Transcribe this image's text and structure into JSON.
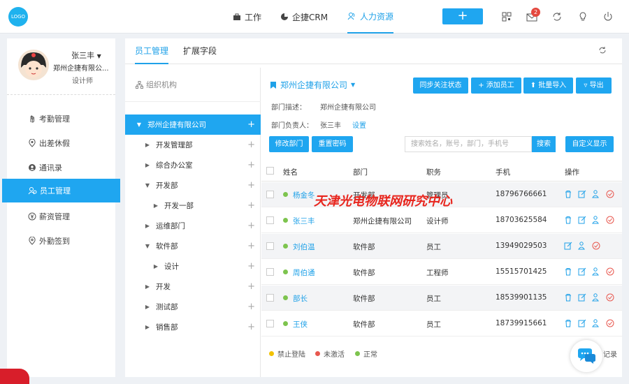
{
  "topbar": {
    "logo": "LOGO",
    "nav": [
      {
        "label": "工作",
        "icon": "briefcase-icon"
      },
      {
        "label": "企捷CRM",
        "icon": "pie-icon"
      },
      {
        "label": "人力资源",
        "icon": "people-icon"
      }
    ],
    "active_nav": "人力资源",
    "plus_label": "+",
    "badge_count": "2"
  },
  "user": {
    "name": "张三丰",
    "company": "郑州企捷有限公...",
    "role": "设计师"
  },
  "sidebar": {
    "items": [
      {
        "label": "考勤管理",
        "icon": "hand-icon"
      },
      {
        "label": "出差休假",
        "icon": "location-icon"
      },
      {
        "label": "通讯录",
        "icon": "contact-icon"
      },
      {
        "label": "员工管理",
        "icon": "staff-icon"
      },
      {
        "label": "薪资管理",
        "icon": "yen-icon"
      },
      {
        "label": "外勤签到",
        "icon": "pin-icon"
      }
    ],
    "active": "员工管理"
  },
  "tabs": [
    "员工管理",
    "扩展字段"
  ],
  "org": {
    "title": "组织机构",
    "tree": [
      {
        "label": "郑州企捷有限公司",
        "caret": "▼",
        "depth": 0,
        "active": true
      },
      {
        "label": "开发管理部",
        "caret": "▶",
        "depth": 1
      },
      {
        "label": "综合办公室",
        "caret": "▶",
        "depth": 1
      },
      {
        "label": "开发部",
        "caret": "▼",
        "depth": 1
      },
      {
        "label": "开发一部",
        "caret": "▶",
        "depth": 2
      },
      {
        "label": "运维部门",
        "caret": "▶",
        "depth": 1
      },
      {
        "label": "软件部",
        "caret": "▼",
        "depth": 1
      },
      {
        "label": "设计",
        "caret": "▶",
        "depth": 2
      },
      {
        "label": "开发",
        "caret": "▶",
        "depth": 1
      },
      {
        "label": "测试部",
        "caret": "▶",
        "depth": 1
      },
      {
        "label": "销售部",
        "caret": "▶",
        "depth": 1
      }
    ]
  },
  "company": {
    "name": "郑州企捷有限公司",
    "desc_label": "部门描述：",
    "desc_value": "郑州企捷有限公司",
    "head_label": "部门负责人：",
    "head_value": "张三丰",
    "head_link": "设置"
  },
  "actions": {
    "sync": "同步关注状态",
    "add": "+ 添加员工",
    "import": "批量导入",
    "export": "导出",
    "edit_dept": "修改部门",
    "reset_pwd": "重置密码",
    "search_placeholder": "搜索姓名，账号，部门，手机号",
    "search": "搜索",
    "custom_display": "自定义显示"
  },
  "table": {
    "headers": [
      "姓名",
      "部门",
      "职务",
      "手机",
      "操作"
    ],
    "rows": [
      {
        "name": "杨金冬",
        "dept": "开发部",
        "title": "管理员",
        "phone": "18796766661",
        "status": "正常",
        "ops": 4
      },
      {
        "name": "张三丰",
        "dept": "郑州企捷有限公司",
        "title": "设计师",
        "phone": "18703625584",
        "status": "正常",
        "ops": 4
      },
      {
        "name": "刘伯温",
        "dept": "软件部",
        "title": "员工",
        "phone": "13949029503",
        "status": "正常",
        "ops": 3
      },
      {
        "name": "周伯通",
        "dept": "软件部",
        "title": "工程师",
        "phone": "15515701425",
        "status": "正常",
        "ops": 4
      },
      {
        "name": "部长",
        "dept": "软件部",
        "title": "员工",
        "phone": "18539901135",
        "status": "正常",
        "ops": 4
      },
      {
        "name": "王侠",
        "dept": "软件部",
        "title": "员工",
        "phone": "18739915661",
        "status": "正常",
        "ops": 4
      }
    ]
  },
  "legend": [
    {
      "label": "禁止登陆",
      "color": "#f2c200"
    },
    {
      "label": "未激活",
      "color": "#e8574e"
    },
    {
      "label": "正常",
      "color": "#7dc44e"
    }
  ],
  "records_text": "记录",
  "watermark": "天津光电物联网研究中心",
  "colors": {
    "accent": "#1fa6f0",
    "normal": "#7dc44e",
    "warn": "#e8574e"
  }
}
